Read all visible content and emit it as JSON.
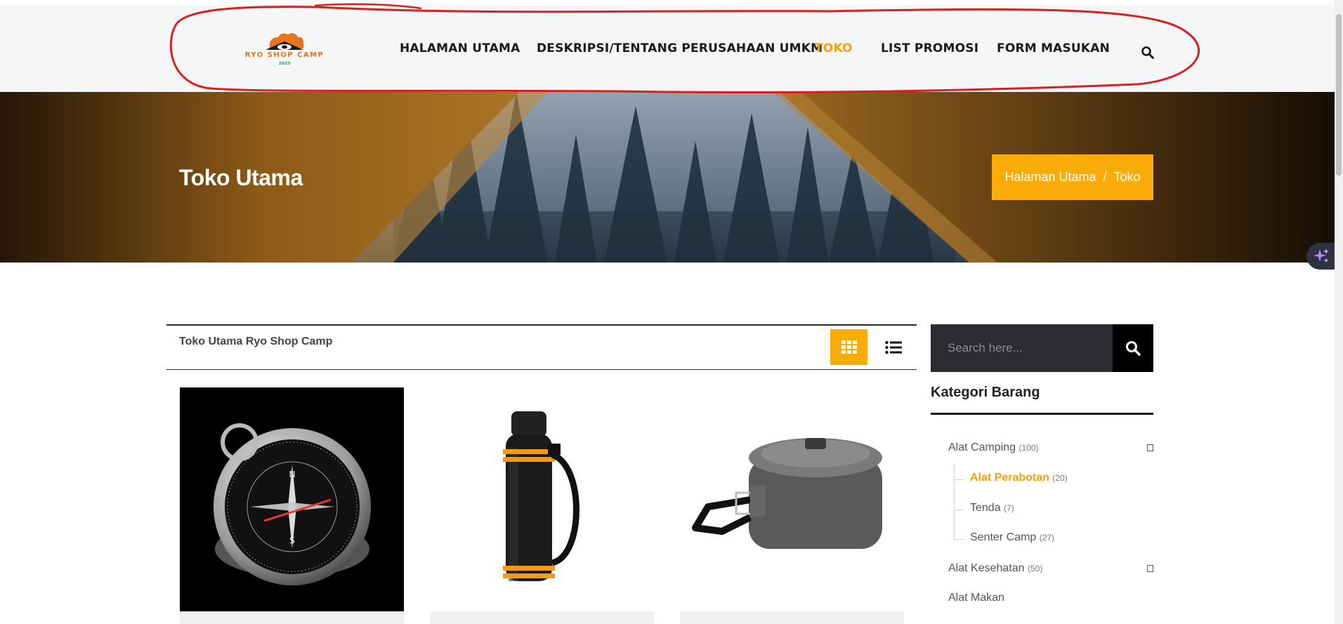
{
  "header": {
    "logo_text": "RYO SHOP CAMP",
    "logo_year": "2023",
    "nav": [
      {
        "label": "HALAMAN UTAMA"
      },
      {
        "label": "DESKRIPSI/TENTANG PERUSAHAAN UMKM"
      },
      {
        "label": "TOKO"
      },
      {
        "label": "LIST PROMOSI"
      },
      {
        "label": "FORM MASUKAN"
      }
    ],
    "active_nav": "TOKO",
    "search_icon": "search-icon"
  },
  "hero": {
    "title": "Toko Utama",
    "breadcrumb": {
      "home": "Halaman Utama",
      "separator": "/",
      "current": "Toko"
    }
  },
  "toolbar": {
    "title": "Toko Utama Ryo Shop Camp",
    "grid_icon": "grid-view-icon",
    "list_icon": "list-view-icon"
  },
  "products": [
    {
      "image": "compass-icon"
    },
    {
      "image": "thermos-flask-icon"
    },
    {
      "image": "camping-pot-icon"
    }
  ],
  "sidebar": {
    "search_placeholder": "Search here...",
    "categories_title": "Kategori Barang",
    "categories": [
      {
        "name": "Alat Camping",
        "count": "(100)"
      },
      {
        "name": "Alat Perabotan",
        "count": "(20)"
      },
      {
        "name": "Tenda",
        "count": "(7)"
      },
      {
        "name": "Senter Camp",
        "count": "(27)"
      },
      {
        "name": "Alat Kesehatan",
        "count": "(50)"
      },
      {
        "name": "Alat Makan",
        "count": ""
      }
    ]
  },
  "colors": {
    "accent": "#f9ab07",
    "annotation": "#d9201f",
    "dark": "#2b2c31"
  }
}
